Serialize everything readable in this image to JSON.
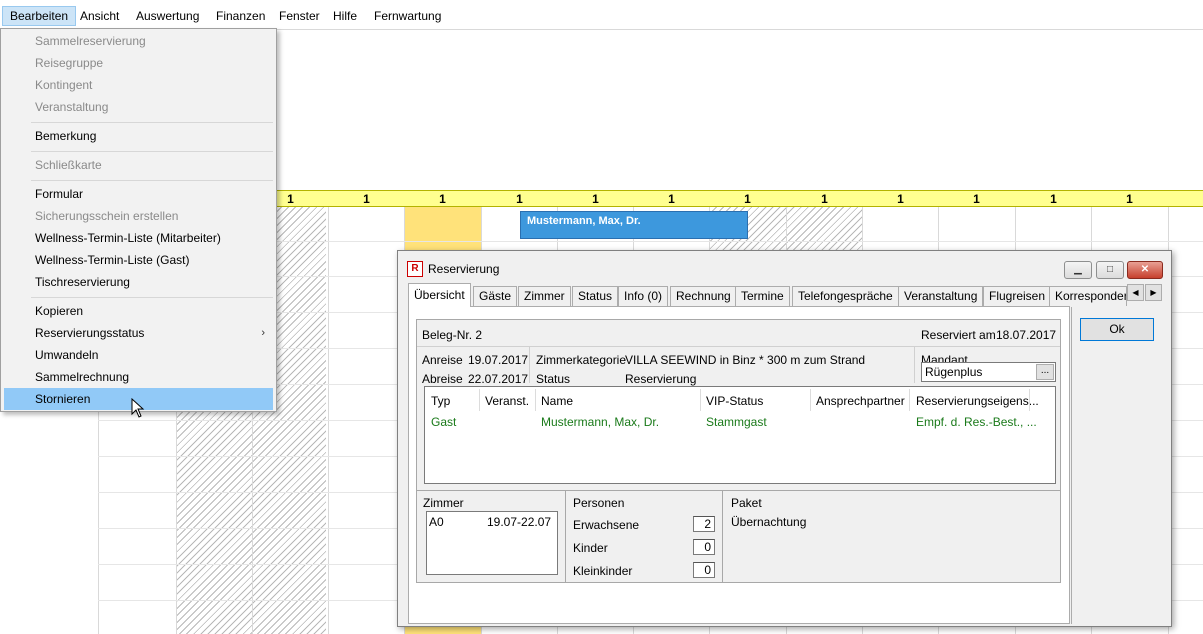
{
  "menubar": {
    "items": [
      "Bearbeiten",
      "Ansicht",
      "Auswertung",
      "Finanzen",
      "Fenster",
      "Hilfe",
      "Fernwartung"
    ]
  },
  "dropdown": {
    "items": [
      {
        "label": "Sammelreservierung",
        "disabled": true
      },
      {
        "label": "Reisegruppe",
        "disabled": true
      },
      {
        "label": "Kontingent",
        "disabled": true
      },
      {
        "label": "Veranstaltung",
        "disabled": true
      },
      {
        "label": "Bemerkung",
        "disabled": false
      },
      {
        "label": "Schließkarte",
        "disabled": true
      },
      {
        "label": "Formular",
        "disabled": false
      },
      {
        "label": "Sicherungsschein erstellen",
        "disabled": true
      },
      {
        "label": "Wellness-Termin-Liste (Mitarbeiter)",
        "disabled": false
      },
      {
        "label": "Wellness-Termin-Liste (Gast)",
        "disabled": false
      },
      {
        "label": "Tischreservierung",
        "disabled": false
      },
      {
        "label": "Kopieren",
        "disabled": false
      },
      {
        "label": "Reservierungsstatus",
        "disabled": false
      },
      {
        "label": "Umwandeln",
        "disabled": false
      },
      {
        "label": "Sammelrechnung",
        "disabled": false
      },
      {
        "label": "Stornieren",
        "disabled": false,
        "highlighted": true
      }
    ]
  },
  "planner": {
    "header_values": [
      "1",
      "1",
      "1",
      "1",
      "1",
      "1",
      "1",
      "1",
      "1",
      "1",
      "1",
      "1",
      "1"
    ],
    "booking_label": "Mustermann, Max, Dr."
  },
  "dialog": {
    "title": "Reservierung",
    "tabs": [
      "Übersicht",
      "Gäste",
      "Zimmer",
      "Status",
      "Info (0)",
      "Rechnung",
      "Termine",
      "Telefongespräche",
      "Veranstaltung",
      "Flugreisen",
      "Korresponder"
    ],
    "ok_label": "Ok",
    "beleg": "Beleg-Nr. 2",
    "reserviert_label": "Reserviert am",
    "reserviert_date": "18.07.2017",
    "anreise_label": "Anreise",
    "anreise": "19.07.2017",
    "abreise_label": "Abreise",
    "abreise": "22.07.2017",
    "zimmerkategorie_label": "Zimmerkategorie",
    "zimmerkategorie": "VILLA SEEWIND in Binz * 300 m zum Strand",
    "status_label": "Status",
    "status": "Reservierung",
    "mandant_label": "Mandant",
    "mandant": "Rügenplus",
    "mandant_btn": "...",
    "guest_table": {
      "headers": [
        "Typ",
        "Veranst.",
        "Name",
        "VIP-Status",
        "Ansprechpartner",
        "Reservierungseigens..."
      ],
      "rows": [
        [
          "Gast",
          "",
          "Mustermann, Max, Dr.",
          "Stammgast",
          "",
          "Empf. d. Res.-Best., ..."
        ]
      ]
    },
    "zimmer_label": "Zimmer",
    "zimmer_row": {
      "room": "A0",
      "dates": "19.07-22.07"
    },
    "personen_label": "Personen",
    "erwachsene_label": "Erwachsene",
    "erwachsene": "2",
    "kinder_label": "Kinder",
    "kinder": "0",
    "kleinkinder_label": "Kleinkinder",
    "kleinkinder": "0",
    "paket_label": "Paket",
    "paket": "Übernachtung"
  }
}
